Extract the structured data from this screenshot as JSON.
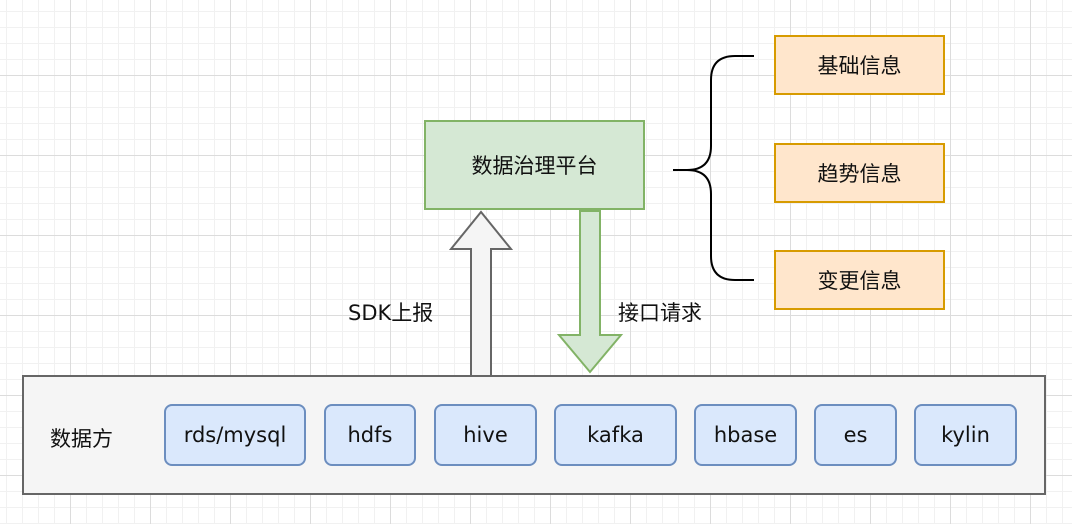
{
  "platform": {
    "label": "数据治理平台"
  },
  "info_boxes": [
    "基础信息",
    "趋势信息",
    "变更信息"
  ],
  "arrows": {
    "up_label": "SDK上报",
    "down_label": "接口请求"
  },
  "container": {
    "label": "数据方"
  },
  "sources": [
    "rds/mysql",
    "hdfs",
    "hive",
    "kafka",
    "hbase",
    "es",
    "kylin"
  ],
  "colors": {
    "platform_fill": "#d5e8d4",
    "platform_border": "#82b366",
    "info_fill": "#ffe6cc",
    "info_border": "#d79b00",
    "source_fill": "#dae8fc",
    "source_border": "#6c8ebf",
    "container_fill": "#f5f5f5",
    "container_border": "#666666"
  }
}
